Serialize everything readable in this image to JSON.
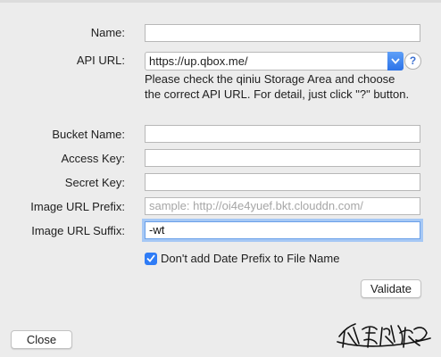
{
  "form": {
    "name": {
      "label": "Name:",
      "value": ""
    },
    "api_url": {
      "label": "API URL:",
      "value": "https://up.qbox.me/",
      "help": "?",
      "hint": "Please check the qiniu Storage Area and choose the correct API URL. For detail, just click \"?\" button."
    },
    "bucket_name": {
      "label": "Bucket Name:",
      "value": ""
    },
    "access_key": {
      "label": "Access Key:",
      "value": ""
    },
    "secret_key": {
      "label": "Secret Key:",
      "value": ""
    },
    "image_url_prefix": {
      "label": "Image URL Prefix:",
      "placeholder": "sample: http://oi4e4yuef.bkt.clouddn.com/"
    },
    "image_url_suffix": {
      "label": "Image URL Suffix:",
      "value": "-wt"
    },
    "date_prefix_checkbox": {
      "label": "Don't add Date Prefix to File Name",
      "checked": true
    }
  },
  "buttons": {
    "validate": "Validate",
    "close": "Close"
  },
  "colors": {
    "accent": "#2f7cf6",
    "focus_ring": "#a6c8f5",
    "background": "#ececec"
  }
}
